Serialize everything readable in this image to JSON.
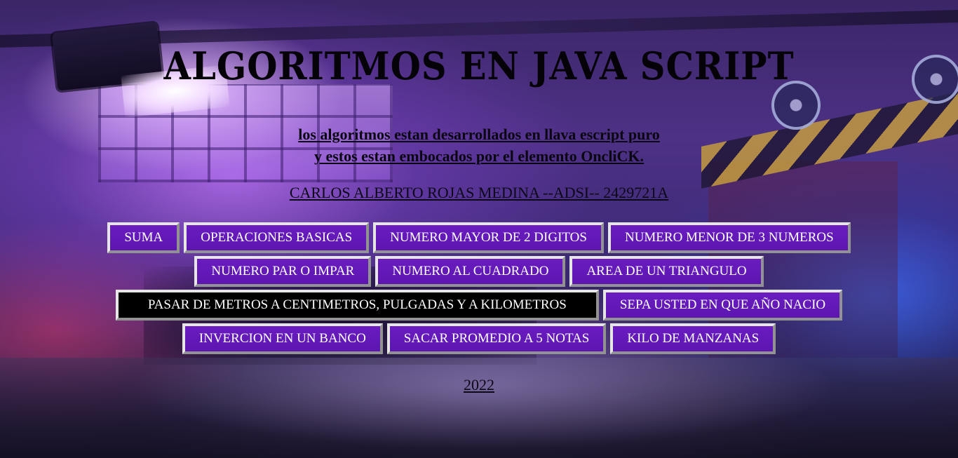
{
  "page": {
    "title": "ALGORITMOS EN JAVA SCRIPT",
    "intro_line1": "los algoritmos estan desarrollados en llava escript puro",
    "intro_line2": "y estos estan embocados por el elemento OncliCK.",
    "author": "CARLOS ALBERTO ROJAS MEDINA --ADSI-- 2429721A",
    "year": "2022"
  },
  "buttons": {
    "row1": [
      "SUMA",
      "OPERACIONES BASICAS",
      "NUMERO MAYOR DE 2 DIGITOS",
      "NUMERO MENOR DE 3 NUMEROS"
    ],
    "row2": [
      "NUMERO PAR O IMPAR",
      "NUMERO AL CUADRADO",
      "AREA DE UN TRIANGULO"
    ],
    "row3": [
      "PASAR DE METROS A CENTIMETROS, PULGADAS Y A KILOMETROS",
      "SEPA USTED EN QUE AÑO NACIO"
    ],
    "row4": [
      "INVERCION EN UN BANCO",
      "SACAR PROMEDIO A 5 NOTAS",
      "KILO DE MANZANAS"
    ]
  },
  "colors": {
    "button_bg": "#6a1cc0",
    "button_active_bg": "#000000",
    "button_text": "#ffffff",
    "button_border": "#e6e6e6"
  },
  "background": {
    "description_icon": "garage-scene-background"
  }
}
